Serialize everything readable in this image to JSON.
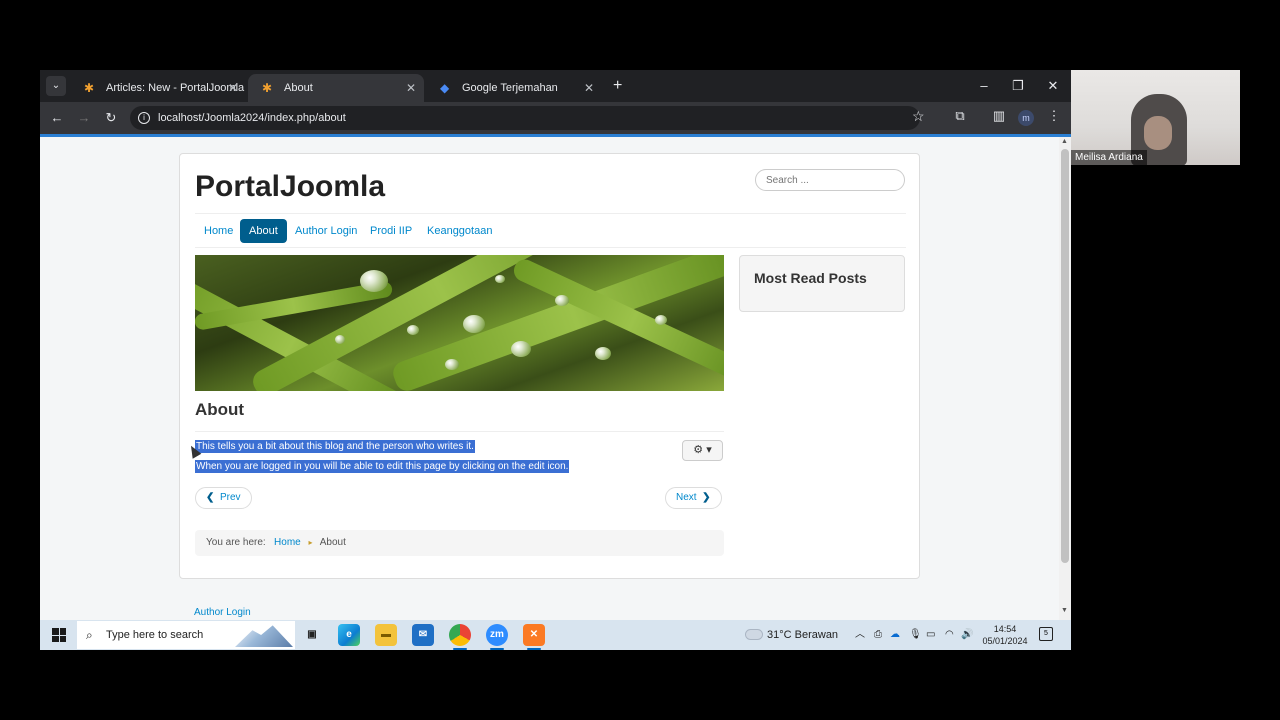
{
  "browser": {
    "tabs": [
      {
        "title": "Articles: New - PortalJoomla - A",
        "favicon": "joomla-icon",
        "active": false
      },
      {
        "title": "About",
        "favicon": "joomla-icon",
        "active": true
      },
      {
        "title": "Google Terjemahan",
        "favicon": "google-translate-icon",
        "active": false
      }
    ],
    "new_tab": "+",
    "url": "localhost/Joomla2024/index.php/about",
    "profile_initial": "m"
  },
  "site": {
    "brand": "PortalJoomla",
    "search_placeholder": "Search ...",
    "menu": [
      {
        "label": "Home",
        "active": false
      },
      {
        "label": "About",
        "active": true
      },
      {
        "label": "Author Login",
        "active": false
      },
      {
        "label": "Prodi IIP",
        "active": false
      },
      {
        "label": "Keanggotaan",
        "active": false
      }
    ],
    "article": {
      "title": "About",
      "paragraphs": [
        "This tells you a bit about this blog and the person who writes it.",
        "When you are logged in you will be able to edit this page by clicking on the edit icon."
      ],
      "selected": true
    },
    "pager": {
      "prev": "Prev",
      "next": "Next"
    },
    "breadcrumb": {
      "prefix": "You are here:",
      "home": "Home",
      "current": "About"
    },
    "sidebar_title": "Most Read Posts",
    "footer_link": "Author Login"
  },
  "taskbar": {
    "search_placeholder": "Type here to search",
    "apps": [
      "task-view",
      "edge",
      "file-explorer",
      "mail",
      "chrome",
      "zoom",
      "xampp"
    ],
    "weather": "31°C  Berawan",
    "time": "14:54",
    "date": "05/01/2024",
    "notification_count": "5"
  },
  "webcam": {
    "participant_name": "Meilisa Ardiana"
  },
  "colors": {
    "accent": "#005e8d",
    "link": "#0088cc",
    "selection": "#3b6fd3"
  }
}
